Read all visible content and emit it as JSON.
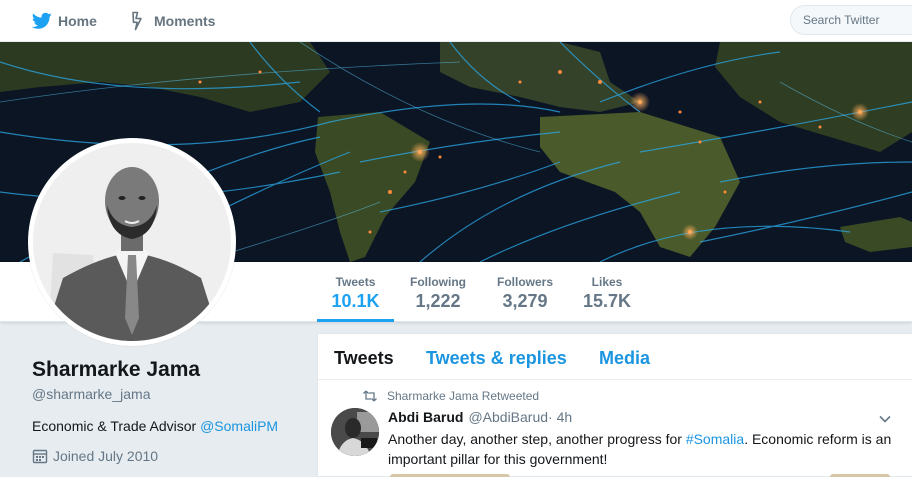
{
  "nav": {
    "home_label": "Home",
    "moments_label": "Moments",
    "search_placeholder": "Search Twitter"
  },
  "profile": {
    "name": "Sharmarke Jama",
    "handle": "@sharmarke_jama",
    "bio_text": "Economic & Trade Advisor ",
    "bio_mention": "@SomaliPM",
    "joined": "Joined July 2010"
  },
  "stats": [
    {
      "label": "Tweets",
      "value": "10.1K"
    },
    {
      "label": "Following",
      "value": "1,222"
    },
    {
      "label": "Followers",
      "value": "3,279"
    },
    {
      "label": "Likes",
      "value": "15.7K"
    }
  ],
  "tabs": [
    {
      "label": "Tweets"
    },
    {
      "label": "Tweets & replies"
    },
    {
      "label": "Media"
    }
  ],
  "tweet": {
    "retweet_context": "Sharmarke Jama Retweeted",
    "author_name": "Abdi Barud",
    "author_handle": "@AbdiBarud",
    "time": " · 4h",
    "text_before": "Another day, another step, another progress for ",
    "hashtag": "#Somalia",
    "text_after": ". Economic reform is an important pillar for this government!"
  },
  "colors": {
    "accent": "#1da1f2",
    "link": "#1b95e0",
    "muted": "#657786",
    "background": "#e6ecf0"
  },
  "icons": {
    "logo": "twitter-bird-icon",
    "moments": "lightning-icon",
    "calendar": "calendar-icon",
    "retweet": "retweet-icon",
    "chevron": "chevron-down-icon"
  }
}
